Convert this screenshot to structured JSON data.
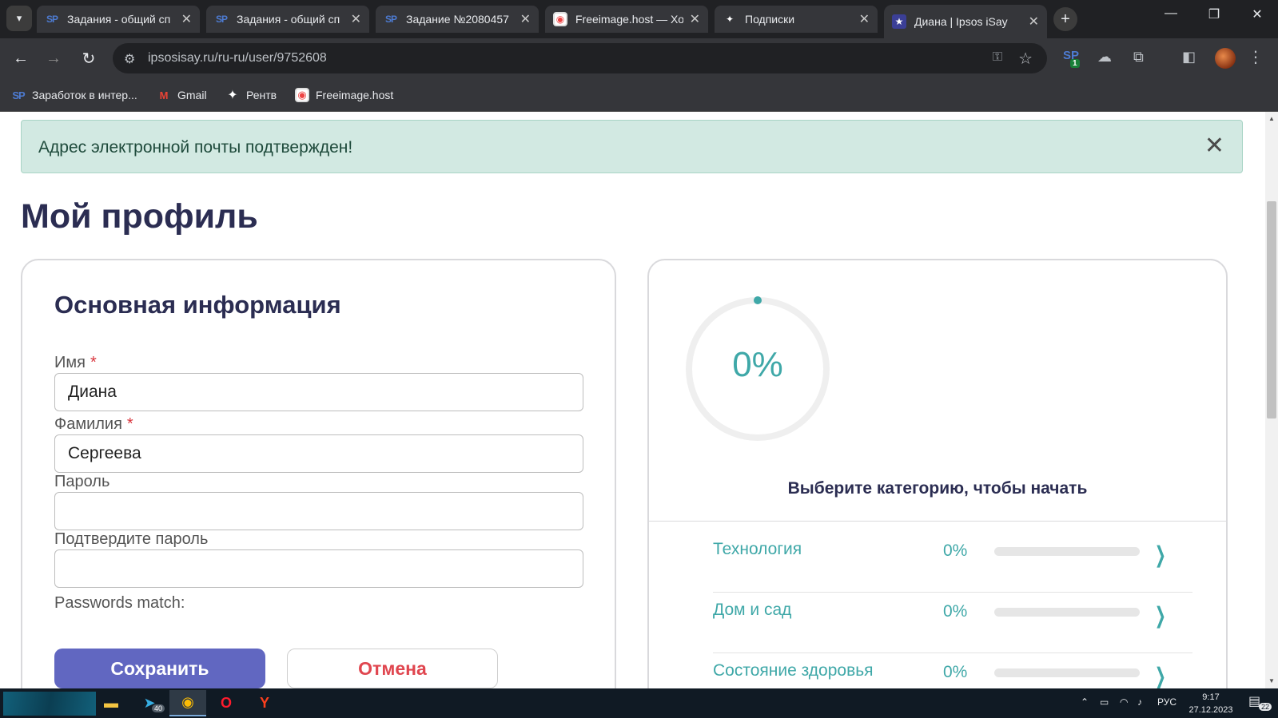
{
  "browser": {
    "tabs": [
      {
        "title": "Задания - общий сп",
        "favicon": "sp-icon"
      },
      {
        "title": "Задания - общий сп",
        "favicon": "sp-icon"
      },
      {
        "title": "Задание №2080457",
        "favicon": "sp-icon"
      },
      {
        "title": "Freeimage.host — Хо",
        "favicon": "freeimage-icon"
      },
      {
        "title": "Подписки",
        "favicon": "star-icon"
      },
      {
        "title": "Диана | Ipsos iSay",
        "favicon": "ipsos-icon",
        "active": true
      }
    ],
    "url": "ipsosisay.ru/ru-ru/user/9752608",
    "extension_badge": "1",
    "bookmarks": [
      {
        "label": "Заработок в интер...",
        "icon": "sp-icon"
      },
      {
        "label": "Gmail",
        "icon": "gmail-icon"
      },
      {
        "label": "Рентв",
        "icon": "star-icon"
      },
      {
        "label": "Freeimage.host",
        "icon": "freeimage-icon"
      }
    ]
  },
  "page": {
    "alert": {
      "text": "Адрес электронной почты подтвержден!"
    },
    "title": "Мой профиль",
    "basic_info": {
      "title": "Основная информация",
      "first_name": {
        "label": "Имя",
        "required_mark": "*",
        "value": "Диана"
      },
      "last_name": {
        "label": "Фамилия",
        "required_mark": "*",
        "value": "Сергеева"
      },
      "password": {
        "label": "Пароль",
        "value": ""
      },
      "confirm_password": {
        "label": "Подтвердите пароль",
        "value": ""
      },
      "passwords_match": "Passwords match:",
      "save_label": "Сохранить",
      "cancel_label": "Отмена"
    },
    "progress": {
      "percent_text": "0%",
      "percent_value": 0,
      "prompt": "Выберите категорию, чтобы начать",
      "categories": [
        {
          "name": "Технология",
          "percent_text": "0%",
          "percent_value": 0
        },
        {
          "name": "Дом и сад",
          "percent_text": "0%",
          "percent_value": 0
        },
        {
          "name": "Состояние здоровья",
          "percent_text": "0%",
          "percent_value": 0
        }
      ]
    }
  },
  "taskbar": {
    "telegram_badge": "40",
    "language": "РУС",
    "time": "9:17",
    "date": "27.12.2023",
    "notifications_badge": "22"
  },
  "colors": {
    "accent_teal": "#3fa8a8",
    "primary_button": "#6167c1",
    "cancel_text": "#e0464f",
    "heading": "#2b2d52",
    "alert_bg": "#d2e9e2"
  }
}
